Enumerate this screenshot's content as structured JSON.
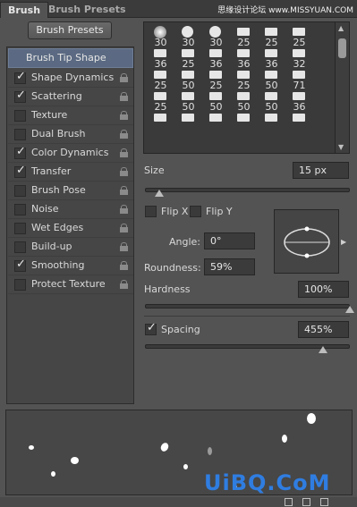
{
  "tabs": {
    "brush": "Brush",
    "brush_presets": "Brush Presets"
  },
  "watermark": "思缘设计论坛 www.MISSYUAN.COM",
  "brush_presets_button": "Brush Presets",
  "brush_tip_shape": "Brush Tip Shape",
  "options": [
    {
      "label": "Shape Dynamics",
      "checked": true
    },
    {
      "label": "Scattering",
      "checked": true
    },
    {
      "label": "Texture",
      "checked": false
    },
    {
      "label": "Dual Brush",
      "checked": false
    },
    {
      "label": "Color Dynamics",
      "checked": true
    },
    {
      "label": "Transfer",
      "checked": true
    },
    {
      "label": "Brush Pose",
      "checked": false
    },
    {
      "label": "Noise",
      "checked": false
    },
    {
      "label": "Wet Edges",
      "checked": false
    },
    {
      "label": "Build-up",
      "checked": false
    },
    {
      "label": "Smoothing",
      "checked": true
    },
    {
      "label": "Protect Texture",
      "checked": false
    }
  ],
  "brush_grid": [
    [
      "30",
      "30",
      "30",
      "25",
      "25",
      "25"
    ],
    [
      "36",
      "25",
      "36",
      "36",
      "36",
      "32"
    ],
    [
      "25",
      "50",
      "25",
      "25",
      "50",
      "71"
    ],
    [
      "25",
      "50",
      "50",
      "50",
      "50",
      "36"
    ],
    [
      "",
      "",
      "",
      "",
      "",
      ""
    ]
  ],
  "size": {
    "label": "Size",
    "value": "15 px",
    "slider_fraction": 0.07
  },
  "flip_x": {
    "label": "Flip X",
    "checked": false
  },
  "flip_y": {
    "label": "Flip Y",
    "checked": false
  },
  "angle": {
    "label": "Angle:",
    "value": "0°"
  },
  "roundness": {
    "label": "Roundness:",
    "value": "59%"
  },
  "hardness": {
    "label": "Hardness",
    "value": "100%",
    "slider_fraction": 1.0
  },
  "spacing": {
    "label": "Spacing",
    "value": "455%",
    "checked": true,
    "slider_fraction": 0.87
  },
  "brand": "UiBQ.CoM",
  "colors": {
    "panel": "#535353",
    "highlight": "#5b6a82",
    "brand": "#2f7de1"
  }
}
